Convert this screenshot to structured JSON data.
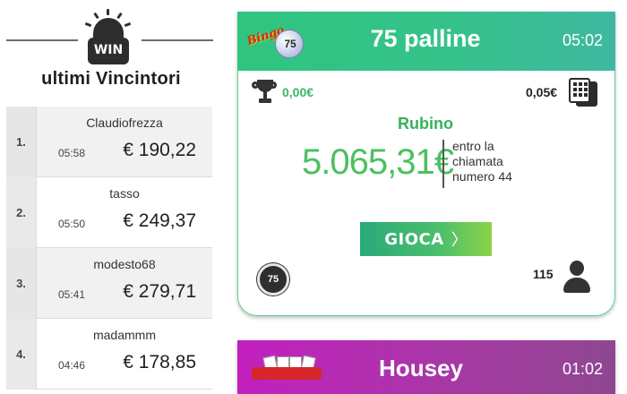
{
  "winners_panel": {
    "badge": "WIN",
    "title": "ultimi Vincintori",
    "rows": [
      {
        "rank": "1.",
        "user": "Claudiofrezza",
        "time": "05:58",
        "amount": "€ 190,22"
      },
      {
        "rank": "2.",
        "user": "tasso",
        "time": "05:50",
        "amount": "€ 249,37"
      },
      {
        "rank": "3.",
        "user": "modesto68",
        "time": "05:41",
        "amount": "€ 279,71"
      },
      {
        "rank": "4.",
        "user": "madammm",
        "time": "04:46",
        "amount": "€ 178,85"
      }
    ]
  },
  "game_card": {
    "logo_ball": "75",
    "name": "75 palline",
    "countdown": "05:02",
    "jackpot": "0,00€",
    "card_price": "0,05€",
    "prize_name": "Rubino",
    "prize_amount": "5.065,31€",
    "prize_note": [
      "entro la",
      "chiamata",
      "numero 44"
    ],
    "play_label": "GIOCA",
    "play_chevron": "〉",
    "ball_badge": "75",
    "players": "115",
    "icons": [
      "trophy-icon",
      "cards-icon",
      "ball-75-icon",
      "user-icon"
    ],
    "colors": {
      "header": "#2fc47f",
      "prize": "#4cc060"
    }
  },
  "game_card_2": {
    "name": "Housey",
    "countdown": "01:02",
    "colors": {
      "header": "#c21fbf"
    }
  }
}
